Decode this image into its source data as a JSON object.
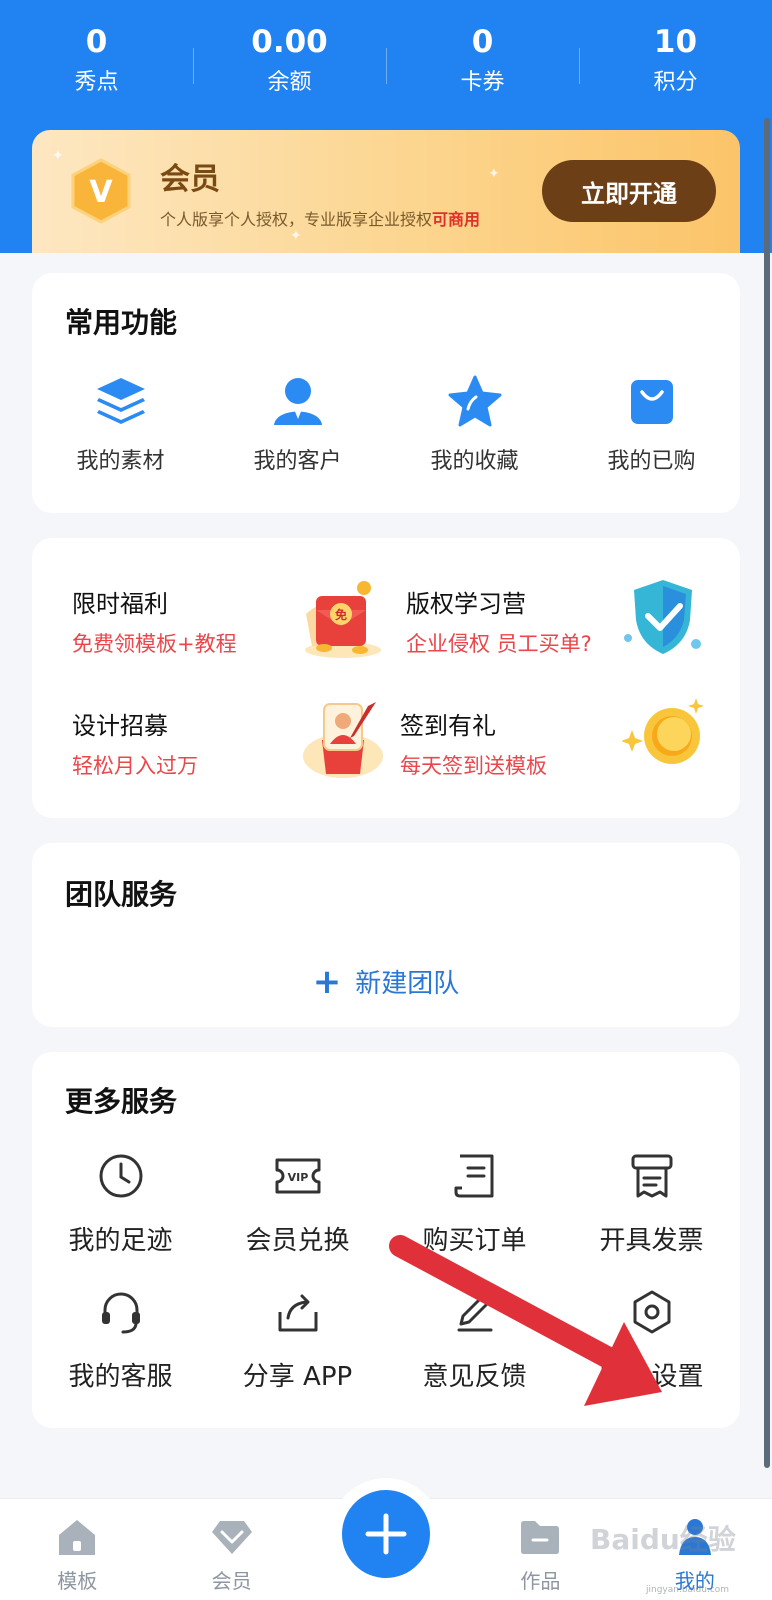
{
  "stats": [
    {
      "value": "0",
      "label": "秀点"
    },
    {
      "value": "0.00",
      "label": "余额"
    },
    {
      "value": "0",
      "label": "卡券"
    },
    {
      "value": "10",
      "label": "积分"
    }
  ],
  "vip": {
    "badge_letter": "V",
    "title": "会员",
    "desc_prefix": "个人版享个人授权，专业版享企业授权",
    "desc_highlight": "可商用",
    "button": "立即开通"
  },
  "common": {
    "title": "常用功能",
    "items": [
      {
        "label": "我的素材",
        "icon": "layers-icon"
      },
      {
        "label": "我的客户",
        "icon": "user-icon"
      },
      {
        "label": "我的收藏",
        "icon": "star-icon"
      },
      {
        "label": "我的已购",
        "icon": "bag-icon"
      }
    ]
  },
  "promos": [
    {
      "title": "限时福利",
      "subtitle": "免费领模板+教程",
      "icon": "red-envelope-icon",
      "icon_text": "免"
    },
    {
      "title": "版权学习营",
      "subtitle": "企业侵权 员工买单?",
      "icon": "shield-icon"
    },
    {
      "title": "设计招募",
      "subtitle": "轻松月入过万",
      "icon": "designer-icon"
    },
    {
      "title": "签到有礼",
      "subtitle": "每天签到送模板",
      "icon": "coin-icon"
    }
  ],
  "team": {
    "title": "团队服务",
    "new_team": "新建团队"
  },
  "more": {
    "title": "更多服务",
    "items": [
      {
        "label": "我的足迹",
        "icon": "clock-icon"
      },
      {
        "label": "会员兑换",
        "icon": "vip-ticket-icon",
        "icon_text": "VIP"
      },
      {
        "label": "购买订单",
        "icon": "order-icon"
      },
      {
        "label": "开具发票",
        "icon": "invoice-icon"
      },
      {
        "label": "我的客服",
        "icon": "headset-icon"
      },
      {
        "label": "分享 APP",
        "icon": "share-icon"
      },
      {
        "label": "意见反馈",
        "icon": "pen-icon"
      },
      {
        "label": "账号设置",
        "icon": "settings-icon"
      }
    ]
  },
  "tabs": [
    {
      "label": "模板",
      "icon": "home-icon",
      "active": false
    },
    {
      "label": "会员",
      "icon": "diamond-icon",
      "active": false
    },
    {
      "label": "",
      "icon": "plus-icon",
      "active": false
    },
    {
      "label": "作品",
      "icon": "folder-icon",
      "active": false
    },
    {
      "label": "我的",
      "icon": "profile-icon",
      "active": true
    }
  ],
  "watermark": {
    "text": "Baidu经验",
    "sub": "jingyan.baidu.com"
  },
  "colors": {
    "primary": "#2083f1",
    "accent_red": "#e9474b",
    "vip_brown": "#6c3f16",
    "arrow_red": "#e0303a"
  }
}
